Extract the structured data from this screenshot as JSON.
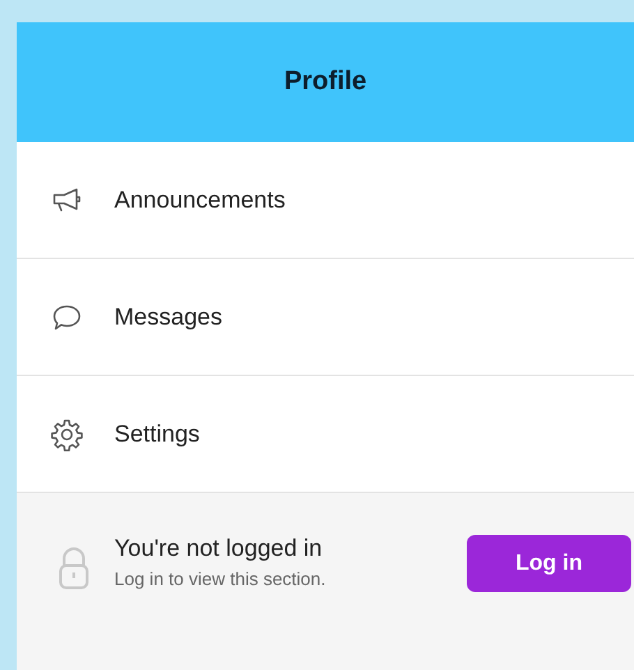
{
  "header": {
    "title": "Profile"
  },
  "menu": [
    {
      "kind": "megaphone",
      "label": "Announcements"
    },
    {
      "kind": "chat",
      "label": "Messages"
    },
    {
      "kind": "gear",
      "label": "Settings"
    }
  ],
  "login_notice": {
    "title": "You're not logged in",
    "subtitle": "Log in to view this section.",
    "button": "Log in"
  }
}
